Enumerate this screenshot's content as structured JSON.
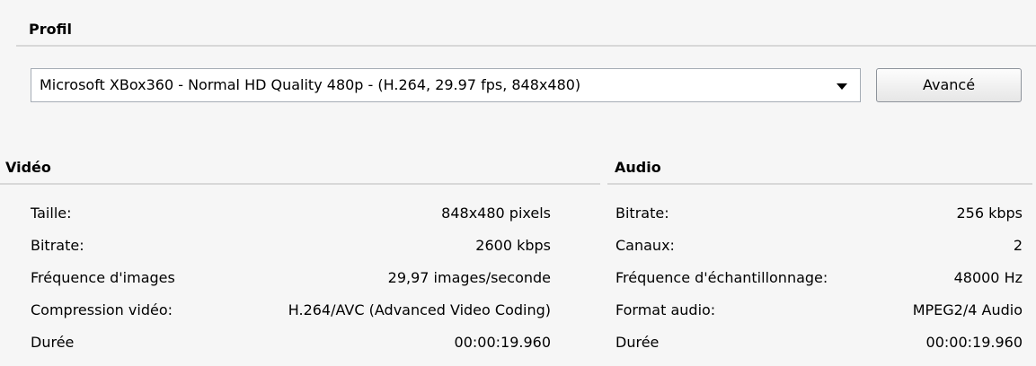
{
  "profile": {
    "title": "Profil",
    "selected": "Microsoft XBox360 - Normal HD Quality 480p - (H.264, 29.97 fps, 848x480)",
    "advanced_button": "Avancé"
  },
  "video": {
    "title": "Vidéo",
    "rows": [
      {
        "label": "Taille:",
        "value": "848x480 pixels"
      },
      {
        "label": "Bitrate:",
        "value": "2600 kbps"
      },
      {
        "label": "Fréquence d'images",
        "value": "29,97 images/seconde"
      },
      {
        "label": "Compression vidéo:",
        "value": "H.264/AVC (Advanced Video Coding)"
      },
      {
        "label": "Durée",
        "value": "00:00:19.960"
      }
    ]
  },
  "audio": {
    "title": "Audio",
    "rows": [
      {
        "label": "Bitrate:",
        "value": "256 kbps"
      },
      {
        "label": "Canaux:",
        "value": "2"
      },
      {
        "label": "Fréquence d'échantillonnage:",
        "value": "48000 Hz"
      },
      {
        "label": "Format audio:",
        "value": "MPEG2/4 Audio"
      },
      {
        "label": "Durée",
        "value": "00:00:19.960"
      }
    ]
  }
}
